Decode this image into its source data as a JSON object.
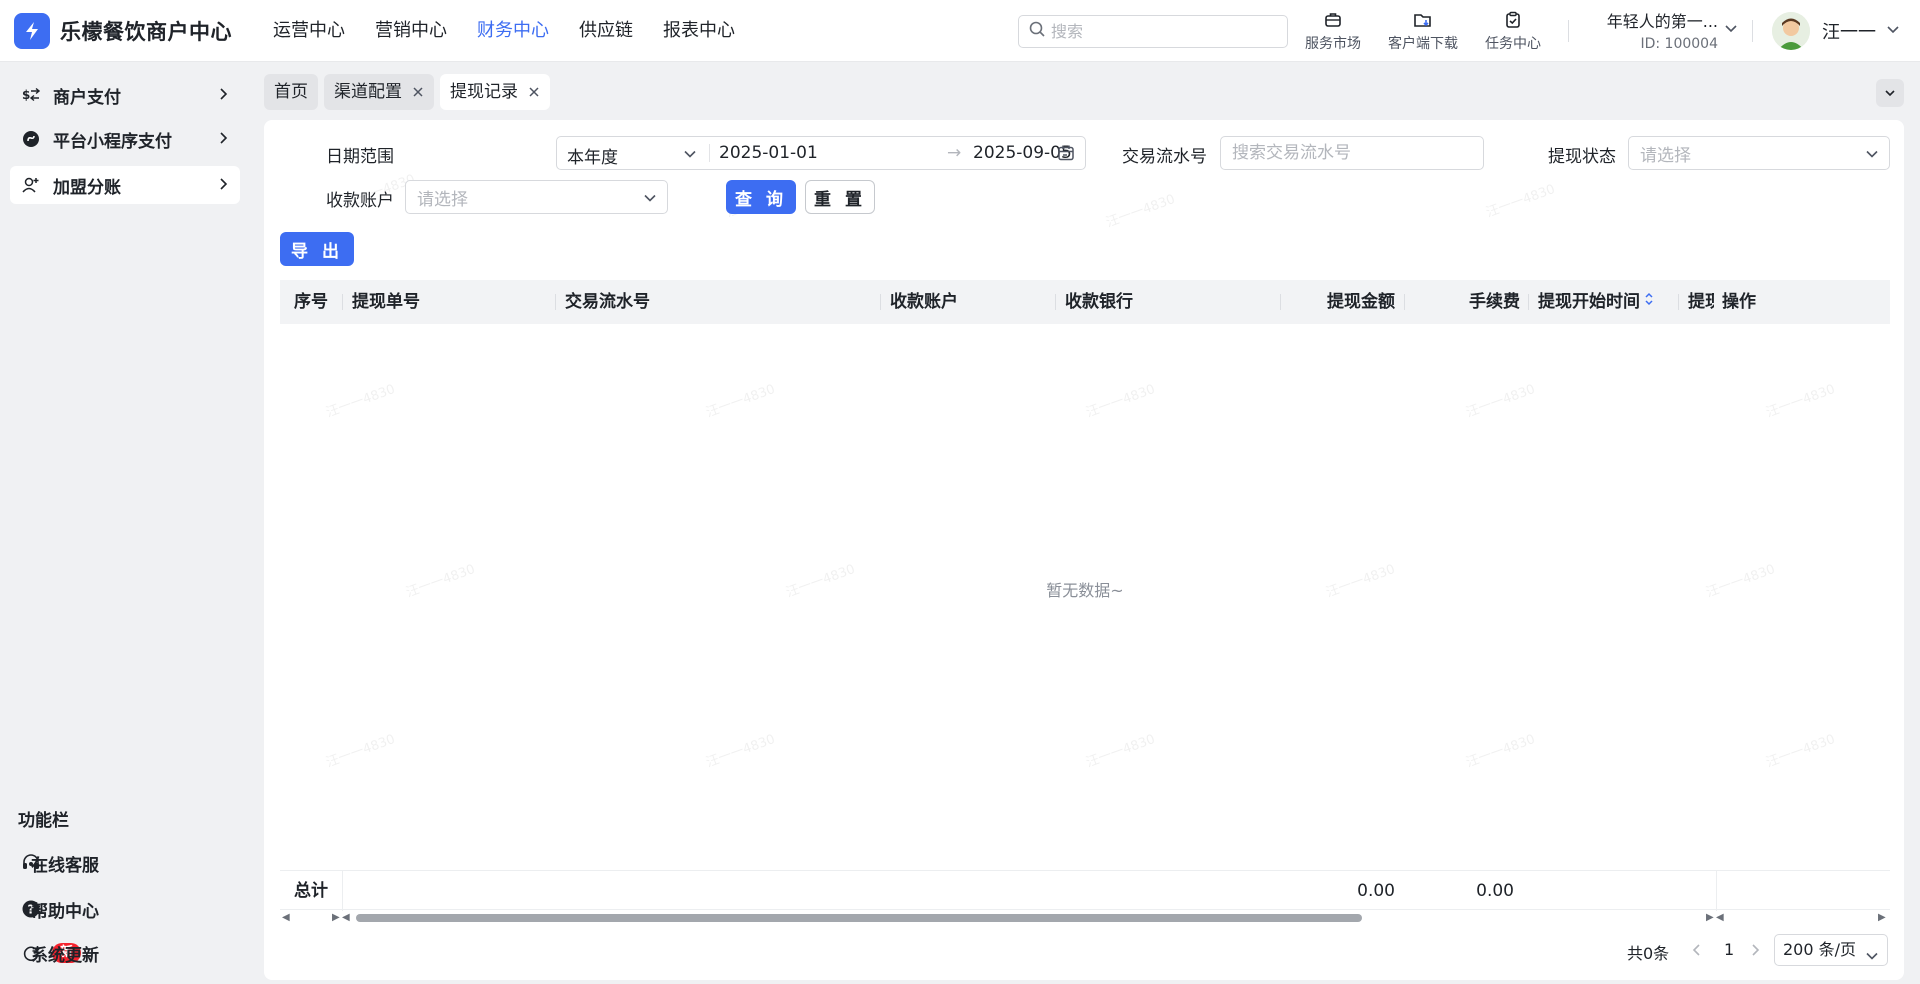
{
  "app": {
    "brand": "乐檬餐饮商户中心",
    "nav": [
      "运营中心",
      "营销中心",
      "财务中心",
      "供应链",
      "报表中心"
    ],
    "nav_active_index": 2,
    "search_placeholder": "搜索",
    "tools": [
      {
        "label": "服务市场",
        "icon": "briefcase-icon"
      },
      {
        "label": "客户端下载",
        "icon": "folder-download-icon"
      },
      {
        "label": "任务中心",
        "icon": "clipboard-check-icon"
      }
    ],
    "store": {
      "name": "年轻人的第一...",
      "id": "ID: 100004"
    },
    "user": {
      "name": "汪一一"
    }
  },
  "sidebar": {
    "items": [
      {
        "label": "商户支付",
        "icon": "dollar-swap-icon"
      },
      {
        "label": "平台小程序支付",
        "icon": "mini-program-icon"
      },
      {
        "label": "加盟分账",
        "icon": "user-add-icon"
      }
    ],
    "active_index": 2,
    "func_title": "功能栏",
    "func_items": [
      {
        "label": "在线客服",
        "icon": "headset-icon"
      },
      {
        "label": "帮助中心",
        "icon": "help-circle-icon"
      },
      {
        "label": "系统更新",
        "icon": "refresh-icon",
        "badge": "新"
      }
    ]
  },
  "tabs": [
    {
      "label": "首页",
      "closable": false
    },
    {
      "label": "渠道配置",
      "closable": true
    },
    {
      "label": "提现记录",
      "closable": true,
      "active": true
    }
  ],
  "filters": {
    "date_label": "日期范围",
    "date_period": "本年度",
    "date_start": "2025-01-01",
    "date_separator": "→",
    "date_end": "2025-09-05",
    "serial_label": "交易流水号",
    "serial_placeholder": "搜索交易流水号",
    "status_label": "提现状态",
    "status_placeholder": "请选择",
    "account_label": "收款账户",
    "account_placeholder": "请选择",
    "query_button": "查 询",
    "reset_button": "重 置",
    "export_button": "导 出"
  },
  "table": {
    "columns": [
      "序号",
      "提现单号",
      "交易流水号",
      "收款账户",
      "收款银行",
      "提现金额",
      "手续费",
      "提现开始时间",
      "提现",
      "操作"
    ],
    "empty_text": "暂无数据~",
    "footer": {
      "label": "总计",
      "amount_total": "0.00",
      "fee_total": "0.00"
    }
  },
  "pagination": {
    "total": "共0条",
    "current_page": "1",
    "page_size": "200 条/页"
  },
  "watermark": "汪一一4830",
  "colors": {
    "primary": "#3d6df2",
    "badge": "#f5222d",
    "sidebar_bg": "#f0f1f3"
  }
}
